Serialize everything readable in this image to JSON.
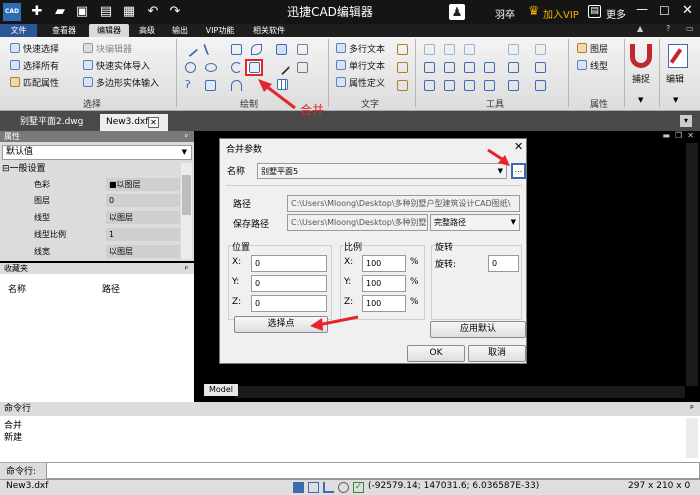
{
  "app": {
    "title": "迅捷CAD编辑器",
    "user": "羽卒",
    "vip": "加入VIP",
    "more": "更多"
  },
  "menu": {
    "tabs": [
      "文件",
      "查看器",
      "编辑器",
      "高级",
      "输出",
      "VIP功能",
      "相关软件"
    ],
    "active": "编辑器"
  },
  "ribbon": {
    "select": {
      "label": "选择",
      "items": [
        "快速选择",
        "选择所有",
        "匹配属性",
        "块编辑器",
        "快速实体导入",
        "多边形实体输入"
      ]
    },
    "draw": {
      "label": "绘制"
    },
    "text": {
      "label": "文字",
      "items": [
        "多行文本",
        "单行文本",
        "属性定义"
      ]
    },
    "tools": {
      "label": "工具"
    },
    "props": {
      "label": "属性",
      "items": [
        "图层",
        "线型"
      ]
    },
    "snap": "捕捉",
    "edit": "编辑"
  },
  "annotation": {
    "text": "合并",
    "color": "#e5242b"
  },
  "doc_tabs": [
    {
      "label": "别墅平面2.dwg"
    },
    {
      "label": "New3.dxf"
    }
  ],
  "properties": {
    "title": "属性",
    "default": "默认值",
    "section": "一般设置",
    "rows": [
      {
        "k": "色彩",
        "v": "■以图层"
      },
      {
        "k": "图层",
        "v": "0"
      },
      {
        "k": "线型",
        "v": "以图层"
      },
      {
        "k": "线型比例",
        "v": "1"
      },
      {
        "k": "线宽",
        "v": "以图层"
      }
    ]
  },
  "favorites": {
    "title": "收藏夹",
    "col_name": "名称",
    "col_path": "路径"
  },
  "canvas": {
    "model_tab": "Model"
  },
  "dialog": {
    "title": "合并参数",
    "name_label": "名称",
    "name_value": "别墅平面5",
    "path_label": "路径",
    "path_value": "C:\\Users\\Mloong\\Desktop\\多种别墅户型建筑设计CAD图纸\\",
    "save_label": "保存路径",
    "save_value": "C:\\Users\\Mloong\\Desktop\\多种别墅",
    "save_mode": "完整路径",
    "position": {
      "label": "位置",
      "x": "0",
      "y": "0",
      "z": "0"
    },
    "scale": {
      "label": "比例",
      "x": "100",
      "y": "100",
      "z": "100",
      "unit": "%"
    },
    "rotation": {
      "label": "旋转",
      "field_label": "旋转:",
      "value": "0"
    },
    "pick_point": "选择点",
    "apply_default": "应用默认",
    "ok": "OK",
    "cancel": "取消",
    "browse": "...",
    "x_label": "X:",
    "y_label": "Y:",
    "z_label": "Z:"
  },
  "command": {
    "title": "命令行",
    "lines": [
      "合并",
      "新建"
    ],
    "prompt": "命令行:"
  },
  "status": {
    "file": "New3.dxf",
    "coords": "(-92579.14; 147031.6; 6.036587E-33)",
    "size": "297 x 210 x 0"
  }
}
